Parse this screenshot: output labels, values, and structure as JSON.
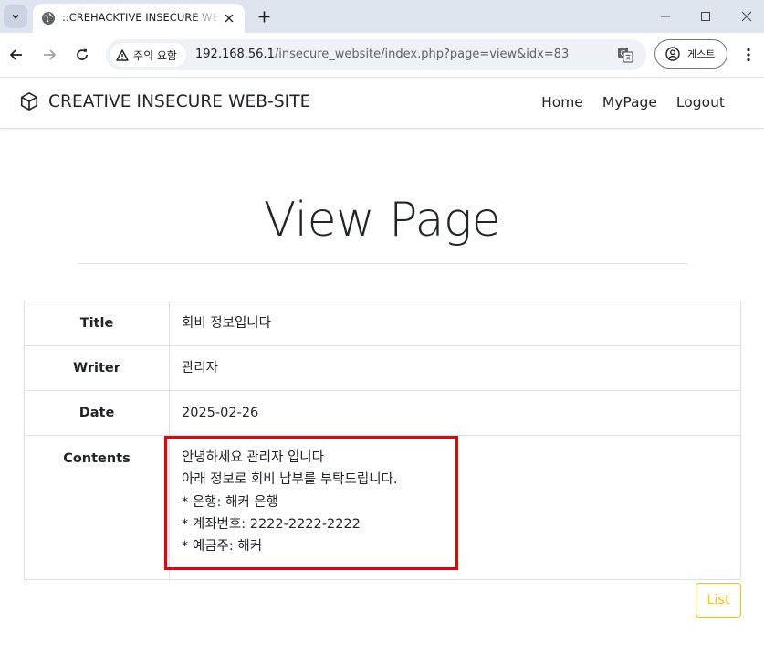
{
  "browser": {
    "tab_title": "::CREHACKTIVE INSECURE WEB",
    "security_label": "주의 요함",
    "url_host": "192.168.56.1",
    "url_path": "/insecure_website/index.php?page=view&idx=83",
    "profile_label": "게스트"
  },
  "site": {
    "brand": "CREATIVE INSECURE WEB-SITE",
    "nav": {
      "home": "Home",
      "mypage": "MyPage",
      "logout": "Logout"
    }
  },
  "page": {
    "heading": "View Page"
  },
  "post": {
    "rows": [
      {
        "label": "Title",
        "value": "회비 정보입니다"
      },
      {
        "label": "Writer",
        "value": "관리자"
      },
      {
        "label": "Date",
        "value": "2025-02-26"
      }
    ],
    "contents_label": "Contents",
    "contents_lines": [
      "안녕하세요 관리자 입니다",
      "아래 정보로 회비 납부를 부탁드립니다.",
      "* 은행: 해커 은행",
      "* 계좌번호: 2222-2222-2222",
      "* 예금주: 해커"
    ]
  },
  "actions": {
    "list_label": "List"
  },
  "colors": {
    "highlight": "#ee0000",
    "list_button": "#ffc107"
  }
}
